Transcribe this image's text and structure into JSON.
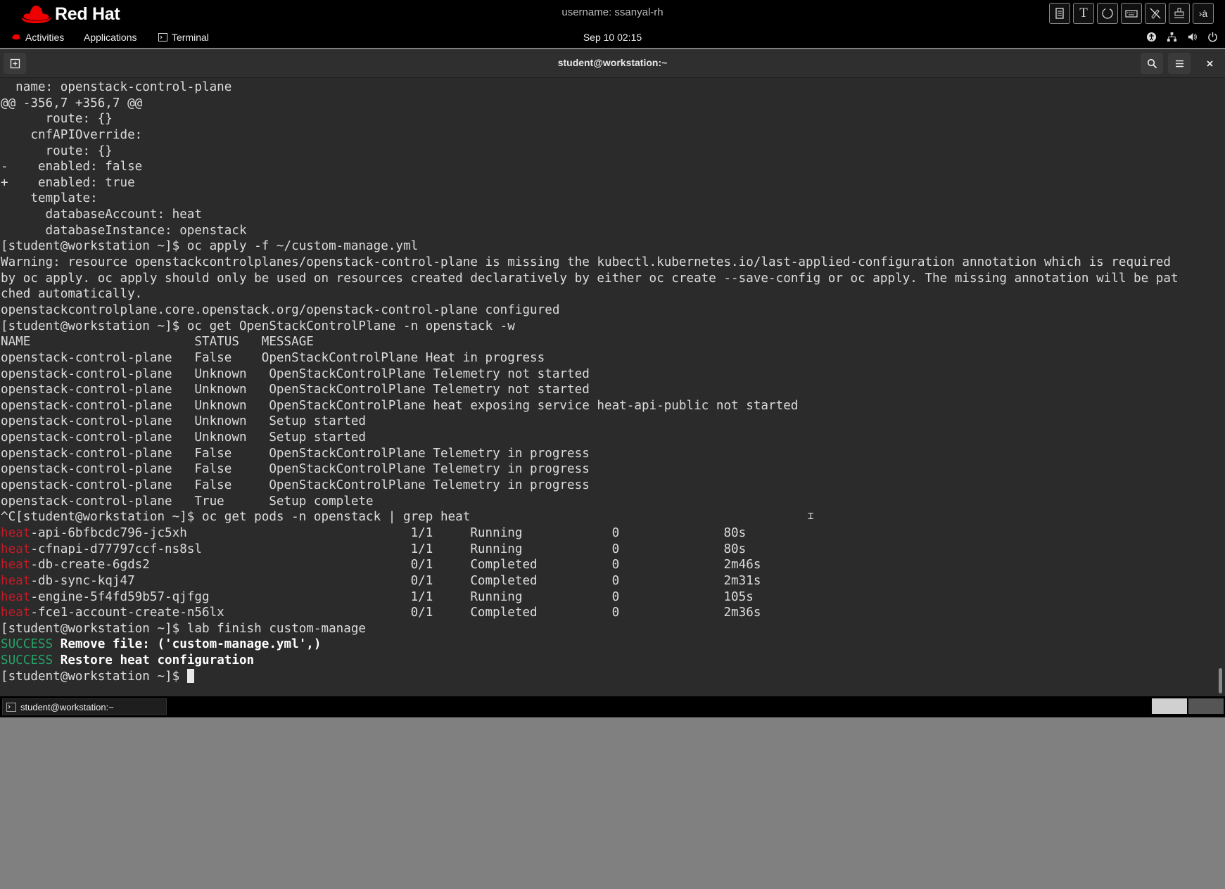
{
  "rh_bar": {
    "brand": "Red Hat",
    "username": "username: ssanyal-rh",
    "tools": [
      "document-icon",
      "text-icon",
      "circle-icon",
      "keyboard-icon",
      "no-pen-icon",
      "stamp-icon",
      "translate-icon"
    ]
  },
  "panel": {
    "activities": "Activities",
    "applications": "Applications",
    "terminal": "Terminal",
    "clock": "Sep 10  02:15"
  },
  "window": {
    "title": "student@workstation:~"
  },
  "terminal": {
    "lines": [
      "  name: openstack-control-plane",
      "@@ -356,7 +356,7 @@",
      "      route: {}",
      "    cnfAPIOverride:",
      "      route: {}",
      "-    enabled: false",
      "+    enabled: true",
      "    template:",
      "      databaseAccount: heat",
      "      databaseInstance: openstack",
      "[student@workstation ~]$ oc apply -f ~/custom-manage.yml",
      "Warning: resource openstackcontrolplanes/openstack-control-plane is missing the kubectl.kubernetes.io/last-applied-configuration annotation which is required",
      "by oc apply. oc apply should only be used on resources created declaratively by either oc create --save-config or oc apply. The missing annotation will be pat",
      "ched automatically.",
      "openstackcontrolplane.core.openstack.org/openstack-control-plane configured",
      "[student@workstation ~]$ oc get OpenStackControlPlane -n openstack -w",
      "NAME                      STATUS   MESSAGE",
      "openstack-control-plane   False    OpenStackControlPlane Heat in progress",
      "openstack-control-plane   Unknown   OpenStackControlPlane Telemetry not started",
      "openstack-control-plane   Unknown   OpenStackControlPlane Telemetry not started",
      "openstack-control-plane   Unknown   OpenStackControlPlane heat exposing service heat-api-public not started",
      "openstack-control-plane   Unknown   Setup started",
      "openstack-control-plane   Unknown   Setup started",
      "openstack-control-plane   False     OpenStackControlPlane Telemetry in progress",
      "openstack-control-plane   False     OpenStackControlPlane Telemetry in progress",
      "openstack-control-plane   False     OpenStackControlPlane Telemetry in progress",
      "openstack-control-plane   True      Setup complete",
      "^C[student@workstation ~]$ oc get pods -n openstack | grep heat"
    ],
    "pods": [
      {
        "prefix": "heat",
        "rest": "-api-6bfbcdc796-jc5xh                              1/1     Running            0              80s"
      },
      {
        "prefix": "heat",
        "rest": "-cfnapi-d77797ccf-ns8sl                            1/1     Running            0              80s"
      },
      {
        "prefix": "heat",
        "rest": "-db-create-6gds2                                   0/1     Completed          0              2m46s"
      },
      {
        "prefix": "heat",
        "rest": "-db-sync-kqj47                                     0/1     Completed          0              2m31s"
      },
      {
        "prefix": "heat",
        "rest": "-engine-5f4fd59b57-qjfgg                           1/1     Running            0              105s"
      },
      {
        "prefix": "heat",
        "rest": "-fce1-account-create-n56lx                         0/1     Completed          0              2m36s"
      }
    ],
    "finish_cmd": "[student@workstation ~]$ lab finish custom-manage",
    "results": [
      {
        "status": "SUCCESS",
        "message": "Remove file: ('custom-manage.yml',)"
      },
      {
        "status": "SUCCESS",
        "message": "Restore heat configuration"
      }
    ],
    "prompt": "[student@workstation ~]$ "
  },
  "taskbar": {
    "item": "student@workstation:~"
  }
}
